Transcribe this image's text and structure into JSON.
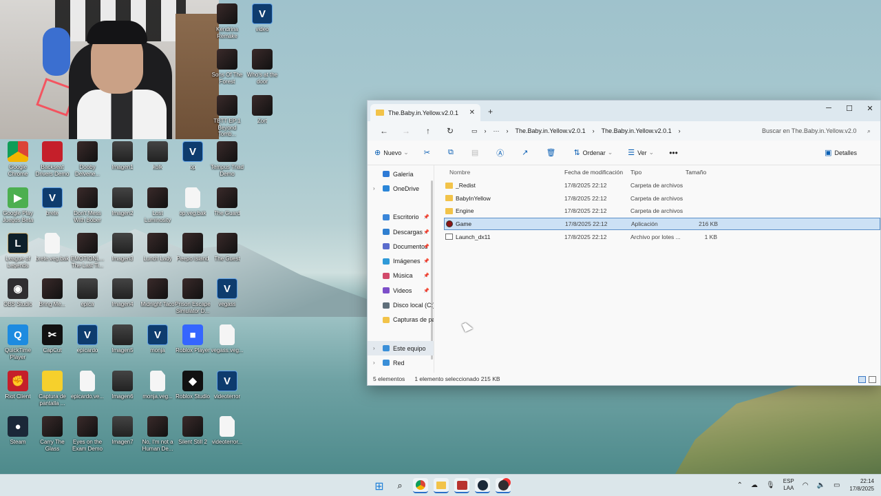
{
  "desktop": {
    "icons": [
      {
        "label": "Google Chrome",
        "icon": "chrome-icon"
      },
      {
        "label": "Backseat Drivers Demo",
        "icon": "car-icon"
      },
      {
        "label": "Dooby Delvene...",
        "icon": "game-icon"
      },
      {
        "label": "Imagen1",
        "icon": "image-icon"
      },
      {
        "label": "kolk",
        "icon": "image-icon"
      },
      {
        "label": "op",
        "icon": "vegas-icon"
      },
      {
        "label": "Tempus Triad Demo",
        "icon": "game-icon"
      },
      {
        "label": "Google Play Juegos Beta",
        "icon": "play-games-icon"
      },
      {
        "label": "brete",
        "icon": "vegas-icon"
      },
      {
        "label": "Don't Mess With Bober",
        "icon": "game-icon"
      },
      {
        "label": "Imagen2",
        "icon": "image-icon"
      },
      {
        "label": "Lost Luminosity",
        "icon": "game-icon"
      },
      {
        "label": "op.veg.bak",
        "icon": "file-icon"
      },
      {
        "label": "The Guard",
        "icon": "game-icon"
      },
      {
        "label": "League of Legends",
        "icon": "lol-icon"
      },
      {
        "label": "brete.veg.bak",
        "icon": "file-icon"
      },
      {
        "label": "EMOTIONL... The Last Ti...",
        "icon": "game-icon"
      },
      {
        "label": "Imagen3",
        "icon": "image-icon"
      },
      {
        "label": "Lunch Lady",
        "icon": "game-icon"
      },
      {
        "label": "Peepo Island",
        "icon": "game-icon"
      },
      {
        "label": "The Guest",
        "icon": "game-icon"
      },
      {
        "label": "OBS Studio",
        "icon": "obs-icon"
      },
      {
        "label": "Bring Me...",
        "icon": "game-icon"
      },
      {
        "label": "epica",
        "icon": "image-icon"
      },
      {
        "label": "Imagen4",
        "icon": "image-icon"
      },
      {
        "label": "Midnight Taco",
        "icon": "game-icon"
      },
      {
        "label": "Prison Escape Simulator D...",
        "icon": "game-icon"
      },
      {
        "label": "vegass",
        "icon": "vegas-icon"
      },
      {
        "label": "QuickTime Player",
        "icon": "quicktime-icon"
      },
      {
        "label": "CapCut",
        "icon": "capcut-icon"
      },
      {
        "label": "epicardo",
        "icon": "vegas-icon"
      },
      {
        "label": "Imagen5",
        "icon": "image-icon"
      },
      {
        "label": "monja",
        "icon": "vegas-icon"
      },
      {
        "label": "Roblox Player",
        "icon": "roblox-icon"
      },
      {
        "label": "vegass.veg...",
        "icon": "file-icon"
      },
      {
        "label": "Riot Client",
        "icon": "riot-icon"
      },
      {
        "label": "Captura de pantalla ...",
        "icon": "screenshot-icon"
      },
      {
        "label": "epicardo.ve...",
        "icon": "file-icon"
      },
      {
        "label": "Imagen6",
        "icon": "image-icon"
      },
      {
        "label": "monja.veg...",
        "icon": "file-icon"
      },
      {
        "label": "Roblox Studio",
        "icon": "roblox-studio-icon"
      },
      {
        "label": "videoterror",
        "icon": "vegas-icon"
      },
      {
        "label": "Steam",
        "icon": "steam-icon"
      },
      {
        "label": "Carry The Glass",
        "icon": "game-icon"
      },
      {
        "label": "Eyes on the Exam Demo",
        "icon": "game-icon"
      },
      {
        "label": "Imagen7",
        "icon": "image-icon"
      },
      {
        "label": "No, I'm not a Human De...",
        "icon": "game-icon"
      },
      {
        "label": "Silent Still 2",
        "icon": "game-icon"
      },
      {
        "label": "videoterror...",
        "icon": "file-icon"
      },
      {
        "label": "Kendrina Remake",
        "icon": "game-icon"
      },
      {
        "label": "video",
        "icon": "vegas-icon"
      },
      {
        "label": "Sons Of The Forest",
        "icon": "game-icon"
      },
      {
        "label": "Who's at the door",
        "icon": "game-icon"
      },
      {
        "label": "TBTT EP:1 Beyond Tomb...",
        "icon": "game-icon"
      },
      {
        "label": "Zort",
        "icon": "game-icon"
      }
    ]
  },
  "explorer": {
    "tab_title": "The.Baby.in.Yellow.v2.0.1",
    "breadcrumb": [
      "The.Baby.in.Yellow.v2.0.1",
      "The.Baby.in.Yellow.v2.0.1"
    ],
    "search_placeholder": "Buscar en The.Baby.in.Yellow.v2.0",
    "toolbar": {
      "new": "Nuevo",
      "sort": "Ordenar",
      "view": "Ver",
      "details": "Detalles"
    },
    "sidebar": [
      {
        "label": "Galería",
        "pinned": false
      },
      {
        "label": "OneDrive",
        "pinned": false
      },
      {
        "label": "Escritorio",
        "pinned": true
      },
      {
        "label": "Descargas",
        "pinned": true
      },
      {
        "label": "Documentos",
        "pinned": true
      },
      {
        "label": "Imágenes",
        "pinned": true
      },
      {
        "label": "Música",
        "pinned": true
      },
      {
        "label": "Videos",
        "pinned": true
      },
      {
        "label": "Disco local (C:)",
        "pinned": false
      },
      {
        "label": "Capturas de par",
        "pinned": false
      },
      {
        "label": "Este equipo",
        "pinned": false
      },
      {
        "label": "Red",
        "pinned": false
      }
    ],
    "columns": {
      "name": "Nombre",
      "date": "Fecha de modificación",
      "type": "Tipo",
      "size": "Tamaño"
    },
    "files": [
      {
        "name": "_Redist",
        "date": "17/8/2025 22:12",
        "type": "Carpeta de archivos",
        "size": "",
        "kind": "folder"
      },
      {
        "name": "BabyInYellow",
        "date": "17/8/2025 22:12",
        "type": "Carpeta de archivos",
        "size": "",
        "kind": "folder"
      },
      {
        "name": "Engine",
        "date": "17/8/2025 22:12",
        "type": "Carpeta de archivos",
        "size": "",
        "kind": "folder"
      },
      {
        "name": "Game",
        "date": "17/8/2025 22:12",
        "type": "Aplicación",
        "size": "216 KB",
        "kind": "app"
      },
      {
        "name": "Launch_dx11",
        "date": "17/8/2025 22:12",
        "type": "Archivo por lotes ...",
        "size": "1 KB",
        "kind": "bat"
      }
    ],
    "status": {
      "count": "5 elementos",
      "selection": "1 elemento seleccionado  215 KB"
    }
  },
  "taskbar": {
    "lang_top": "ESP",
    "lang_bottom": "LAA",
    "time": "22:14",
    "date": "17/8/2025"
  },
  "colors": {
    "accent": "#2a6fc7",
    "selection": "#cce1f5",
    "folder": "#f2c349"
  }
}
